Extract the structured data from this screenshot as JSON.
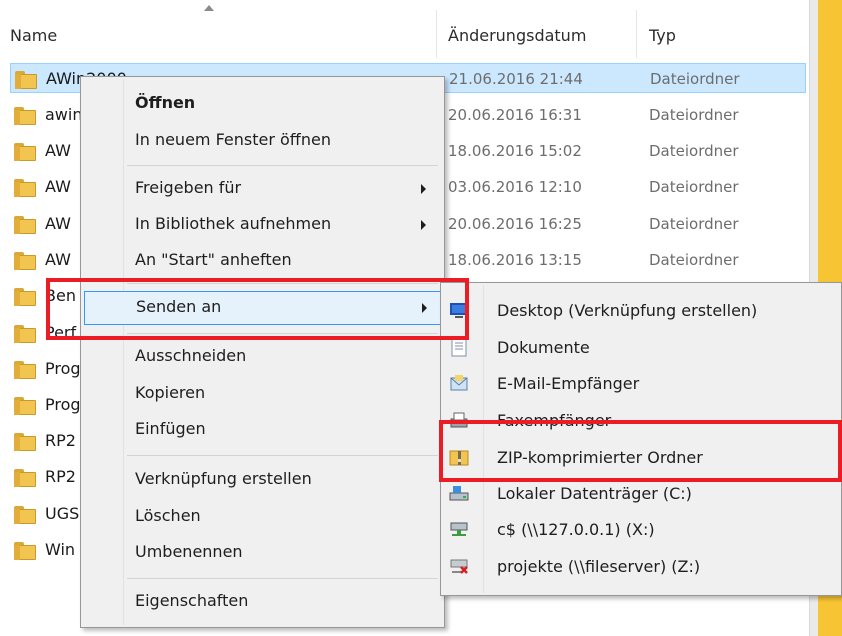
{
  "header": {
    "name": "Name",
    "date": "Änderungsdatum",
    "type": "Typ"
  },
  "rows": [
    {
      "name": "AWin2000",
      "date": "21.06.2016 21:44",
      "type": "Dateiordner",
      "selected": true
    },
    {
      "name": "awin",
      "date": "20.06.2016 16:31",
      "type": "Dateiordner"
    },
    {
      "name": "AW",
      "date": "18.06.2016 15:02",
      "type": "Dateiordner"
    },
    {
      "name": "AW",
      "date": "03.06.2016 12:10",
      "type": "Dateiordner"
    },
    {
      "name": "AW",
      "date": "20.06.2016 16:25",
      "type": "Dateiordner"
    },
    {
      "name": "AW",
      "date": "18.06.2016 13:15",
      "type": "Dateiordner"
    },
    {
      "name": "Ben",
      "date": "",
      "type": ""
    },
    {
      "name": "Perf",
      "date": "",
      "type": ""
    },
    {
      "name": "Prog",
      "date": "",
      "type": ""
    },
    {
      "name": "Prog",
      "date": "",
      "type": ""
    },
    {
      "name": "RP2",
      "date": "",
      "type": ""
    },
    {
      "name": "RP2",
      "date": "",
      "type": ""
    },
    {
      "name": "UGS",
      "date": "",
      "type": ""
    },
    {
      "name": "Win",
      "date": "",
      "type": ""
    }
  ],
  "context_menu": {
    "open": "Öffnen",
    "open_new_window": "In neuem Fenster öffnen",
    "share_with": "Freigeben für",
    "add_to_library": "In Bibliothek aufnehmen",
    "pin_to_start": "An \"Start\" anheften",
    "send_to": "Senden an",
    "cut": "Ausschneiden",
    "copy": "Kopieren",
    "paste": "Einfügen",
    "create_shortcut": "Verknüpfung erstellen",
    "delete": "Löschen",
    "rename": "Umbenennen",
    "properties": "Eigenschaften"
  },
  "send_to_menu": {
    "items": [
      {
        "label": "Desktop (Verknüpfung erstellen)",
        "icon": "desktop-icon"
      },
      {
        "label": "Dokumente",
        "icon": "documents-icon"
      },
      {
        "label": "E-Mail-Empfänger",
        "icon": "mail-recipient-icon"
      },
      {
        "label": "Faxempfänger",
        "icon": "fax-icon"
      },
      {
        "label": "ZIP-komprimierter Ordner",
        "icon": "zip-folder-icon"
      },
      {
        "label": "Lokaler Datenträger (C:)",
        "icon": "local-drive-icon"
      },
      {
        "label": "c$ (\\\\127.0.0.1) (X:)",
        "icon": "network-drive-icon"
      },
      {
        "label": "projekte (\\\\fileserver) (Z:)",
        "icon": "disconnected-drive-icon"
      }
    ]
  },
  "colors": {
    "highlight_box": "#ec1c24",
    "selection": "#cce8ff",
    "menu_hover": "#e5f1fb",
    "side_bar": "#f7c534"
  }
}
